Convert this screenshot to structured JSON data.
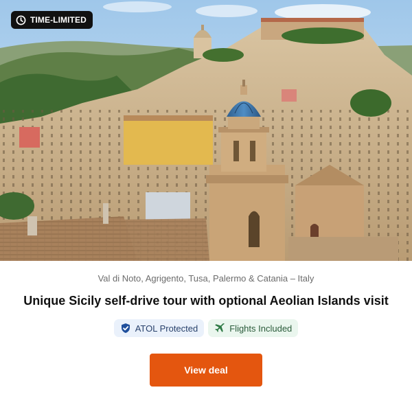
{
  "badge": {
    "label": "TIME-LIMITED",
    "icon": "clock-icon"
  },
  "deal": {
    "location": "Val di Noto, Agrigento, Tusa, Palermo & Catania – Italy",
    "title": "Unique Sicily self-drive tour with optional Aeolian Islands visit",
    "tags": [
      {
        "label": "ATOL Protected",
        "icon": "shield-check-icon"
      },
      {
        "label": "Flights Included",
        "icon": "airplane-icon"
      }
    ],
    "cta_label": "View deal"
  },
  "colors": {
    "cta": "#e4560f",
    "badge_bg": "#111111",
    "atol_tag_bg": "#eaf1fb",
    "flights_tag_bg": "#eaf6ee"
  }
}
